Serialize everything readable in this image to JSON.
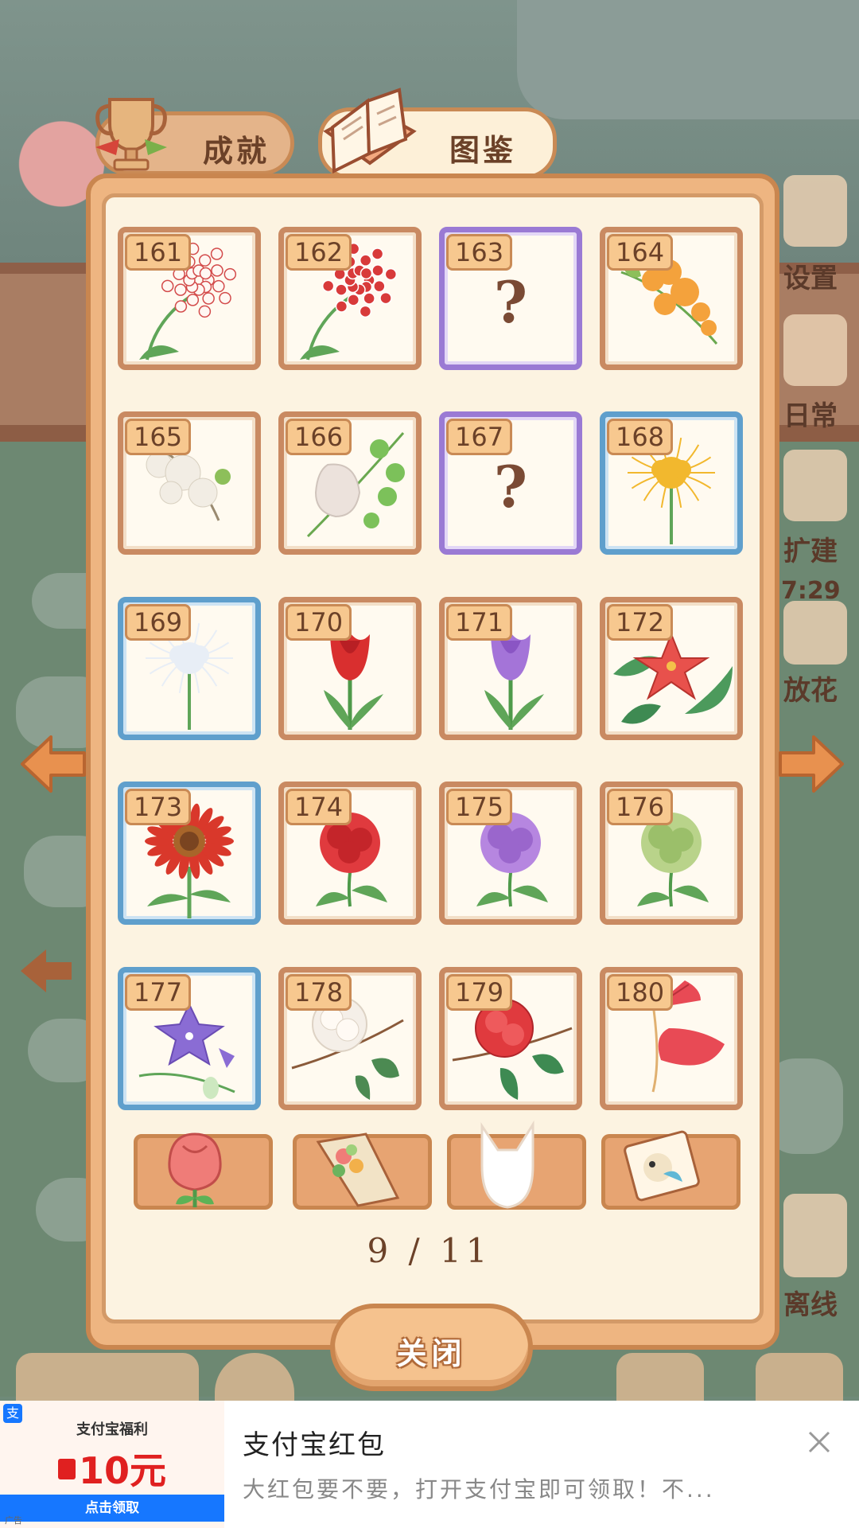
{
  "tabs": {
    "achievements": "成就",
    "atlas": "图鉴"
  },
  "side_labels": [
    "设置",
    "日常",
    "扩建",
    "7:29",
    "放花",
    "离线"
  ],
  "cards": [
    {
      "num": "161",
      "state": "owned",
      "frame": "brown",
      "flower": "hoya-white"
    },
    {
      "num": "162",
      "state": "owned",
      "frame": "brown",
      "flower": "hoya-red"
    },
    {
      "num": "163",
      "state": "unknown",
      "frame": "purple",
      "flower": "question-mark",
      "text": "?"
    },
    {
      "num": "164",
      "state": "owned",
      "frame": "brown",
      "flower": "orange-orchid"
    },
    {
      "num": "165",
      "state": "owned",
      "frame": "brown",
      "flower": "white-bougainvillea"
    },
    {
      "num": "166",
      "state": "owned",
      "frame": "brown",
      "flower": "white-bud-vine"
    },
    {
      "num": "167",
      "state": "unknown",
      "frame": "purple",
      "flower": "question-mark",
      "text": "?"
    },
    {
      "num": "168",
      "state": "owned",
      "frame": "blue",
      "flower": "yellow-spider-lily"
    },
    {
      "num": "169",
      "state": "owned",
      "frame": "blue",
      "flower": "white-spider-lily"
    },
    {
      "num": "170",
      "state": "owned",
      "frame": "brown",
      "flower": "red-tulip"
    },
    {
      "num": "171",
      "state": "owned",
      "frame": "brown",
      "flower": "purple-tulip"
    },
    {
      "num": "172",
      "state": "owned",
      "frame": "brown",
      "flower": "red-ixora"
    },
    {
      "num": "173",
      "state": "owned",
      "frame": "blue",
      "flower": "red-sunflower"
    },
    {
      "num": "174",
      "state": "owned",
      "frame": "brown",
      "flower": "red-carnation"
    },
    {
      "num": "175",
      "state": "owned",
      "frame": "brown",
      "flower": "purple-carnation"
    },
    {
      "num": "176",
      "state": "owned",
      "frame": "brown",
      "flower": "green-carnation"
    },
    {
      "num": "177",
      "state": "owned",
      "frame": "blue",
      "flower": "bellflower"
    },
    {
      "num": "178",
      "state": "owned",
      "frame": "brown",
      "flower": "white-camellia"
    },
    {
      "num": "179",
      "state": "owned",
      "frame": "brown",
      "flower": "red-camellia"
    },
    {
      "num": "180",
      "state": "owned",
      "frame": "brown",
      "flower": "red-fan-flower"
    }
  ],
  "category_tabs": [
    "flower-icon",
    "bouquet-icon",
    "cat-silhouette-icon",
    "photo-card-icon"
  ],
  "pager": "9 / 11",
  "close_label": "关闭",
  "colors": {
    "panel": "#eeb581",
    "panel_inner": "#fcf3e1",
    "frame_brown": "#c98a62",
    "frame_blue": "#5f9fcc",
    "frame_purple": "#9a7ad4",
    "arrow": "#e08a4a"
  },
  "ad": {
    "thumb_title": "支付宝福利",
    "thumb_amount": "10元",
    "thumb_cta": "点击领取",
    "thumb_tag": "广告",
    "title": "支付宝红包",
    "description": "大红包要不要，打开支付宝即可领取！不..."
  }
}
